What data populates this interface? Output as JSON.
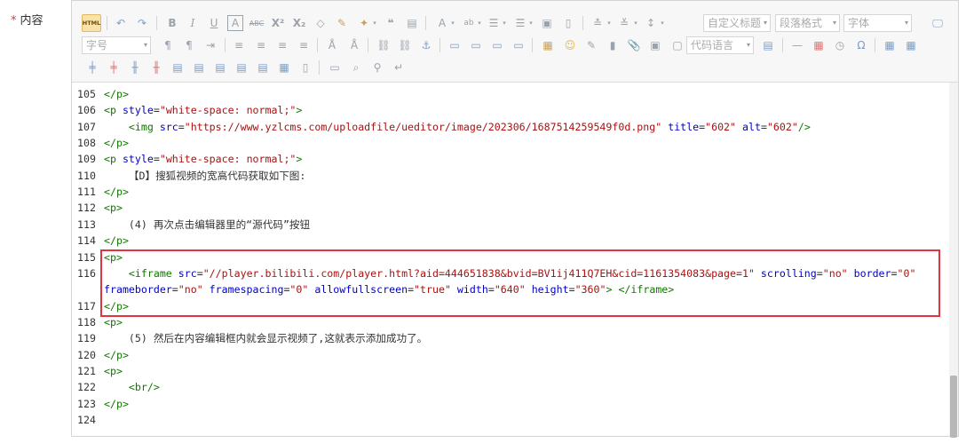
{
  "field": {
    "required_mark": "*",
    "label": "内容"
  },
  "toolbar": {
    "html_label": "HTML",
    "heading_select": "自定义标题",
    "paragraph_select": "段落格式",
    "font_select": "字体",
    "size_select": "字号",
    "code_lang_select": "代码语言"
  },
  "code_lines": [
    {
      "num": "105",
      "parts": [
        {
          "t": "tag",
          "v": "</p>"
        }
      ]
    },
    {
      "num": "106",
      "parts": [
        {
          "t": "tag",
          "v": "<p "
        },
        {
          "t": "attr",
          "v": "style"
        },
        {
          "t": "txt",
          "v": "="
        },
        {
          "t": "str",
          "v": "\"white-space: normal;\""
        },
        {
          "t": "tag",
          "v": ">"
        }
      ]
    },
    {
      "num": "107",
      "parts": [
        {
          "t": "txt",
          "v": "    "
        },
        {
          "t": "tag",
          "v": "<img "
        },
        {
          "t": "attr",
          "v": "src"
        },
        {
          "t": "txt",
          "v": "="
        },
        {
          "t": "str",
          "v": "\"https://www.yzlcms.com/uploadfile/ueditor/image/202306/1687514259549f0d.png\""
        },
        {
          "t": "txt",
          "v": " "
        },
        {
          "t": "attr",
          "v": "title"
        },
        {
          "t": "txt",
          "v": "="
        },
        {
          "t": "str",
          "v": "\"602\""
        },
        {
          "t": "txt",
          "v": " "
        },
        {
          "t": "attr",
          "v": "alt"
        },
        {
          "t": "txt",
          "v": "="
        },
        {
          "t": "str",
          "v": "\"602\""
        },
        {
          "t": "tag",
          "v": "/>"
        }
      ]
    },
    {
      "num": "108",
      "parts": [
        {
          "t": "tag",
          "v": "</p>"
        }
      ]
    },
    {
      "num": "109",
      "parts": [
        {
          "t": "tag",
          "v": "<p "
        },
        {
          "t": "attr",
          "v": "style"
        },
        {
          "t": "txt",
          "v": "="
        },
        {
          "t": "str",
          "v": "\"white-space: normal;\""
        },
        {
          "t": "tag",
          "v": ">"
        }
      ]
    },
    {
      "num": "110",
      "parts": [
        {
          "t": "txt",
          "v": "    【D】搜狐视频的宽高代码获取如下图:"
        }
      ]
    },
    {
      "num": "111",
      "parts": [
        {
          "t": "tag",
          "v": "</p>"
        }
      ]
    },
    {
      "num": "112",
      "parts": [
        {
          "t": "tag",
          "v": "<p>"
        }
      ]
    },
    {
      "num": "113",
      "parts": [
        {
          "t": "txt",
          "v": "    (4) 再次点击编辑器里的“源代码”按钮"
        }
      ]
    },
    {
      "num": "114",
      "parts": [
        {
          "t": "tag",
          "v": "</p>"
        }
      ]
    },
    {
      "num": "115",
      "parts": [
        {
          "t": "tag",
          "v": "<p>"
        }
      ]
    },
    {
      "num": "116",
      "parts": [
        {
          "t": "txt",
          "v": "    "
        },
        {
          "t": "tag",
          "v": "<iframe "
        },
        {
          "t": "attr",
          "v": "src"
        },
        {
          "t": "txt",
          "v": "="
        },
        {
          "t": "str",
          "v": "\"//player.bilibili.com/player.html?aid=444651838&bvid=BV1ij411Q7EH&cid=1161354083&page=1\""
        },
        {
          "t": "txt",
          "v": " "
        },
        {
          "t": "attr",
          "v": "scrolling"
        },
        {
          "t": "txt",
          "v": "="
        },
        {
          "t": "str",
          "v": "\"no\""
        },
        {
          "t": "txt",
          "v": " "
        },
        {
          "t": "attr",
          "v": "border"
        },
        {
          "t": "txt",
          "v": "="
        },
        {
          "t": "str",
          "v": "\"0\""
        }
      ]
    },
    {
      "num": "",
      "parts": [
        {
          "t": "attr",
          "v": "frameborder"
        },
        {
          "t": "txt",
          "v": "="
        },
        {
          "t": "str",
          "v": "\"no\""
        },
        {
          "t": "txt",
          "v": " "
        },
        {
          "t": "attr",
          "v": "framespacing"
        },
        {
          "t": "txt",
          "v": "="
        },
        {
          "t": "str",
          "v": "\"0\""
        },
        {
          "t": "txt",
          "v": " "
        },
        {
          "t": "attr",
          "v": "allowfullscreen"
        },
        {
          "t": "txt",
          "v": "="
        },
        {
          "t": "str",
          "v": "\"true\""
        },
        {
          "t": "txt",
          "v": " "
        },
        {
          "t": "attr",
          "v": "width"
        },
        {
          "t": "txt",
          "v": "="
        },
        {
          "t": "str",
          "v": "\"640\""
        },
        {
          "t": "txt",
          "v": " "
        },
        {
          "t": "attr",
          "v": "height"
        },
        {
          "t": "txt",
          "v": "="
        },
        {
          "t": "str",
          "v": "\"360\""
        },
        {
          "t": "tag",
          "v": "> </iframe>"
        }
      ]
    },
    {
      "num": "117",
      "parts": [
        {
          "t": "tag",
          "v": "</p>"
        }
      ]
    },
    {
      "num": "118",
      "parts": [
        {
          "t": "tag",
          "v": "<p>"
        }
      ]
    },
    {
      "num": "119",
      "parts": [
        {
          "t": "txt",
          "v": "    (5) 然后在内容编辑框内就会显示视频了,这就表示添加成功了。"
        }
      ]
    },
    {
      "num": "120",
      "parts": [
        {
          "t": "tag",
          "v": "</p>"
        }
      ]
    },
    {
      "num": "121",
      "parts": [
        {
          "t": "tag",
          "v": "<p>"
        }
      ]
    },
    {
      "num": "122",
      "parts": [
        {
          "t": "txt",
          "v": "    "
        },
        {
          "t": "tag",
          "v": "<br/>"
        }
      ]
    },
    {
      "num": "123",
      "parts": [
        {
          "t": "tag",
          "v": "</p>"
        }
      ]
    },
    {
      "num": "124",
      "parts": []
    }
  ],
  "colors": {
    "highlight_border": "#e2343e",
    "tag": "#117700",
    "attr": "#0000cc",
    "string": "#aa1111"
  }
}
